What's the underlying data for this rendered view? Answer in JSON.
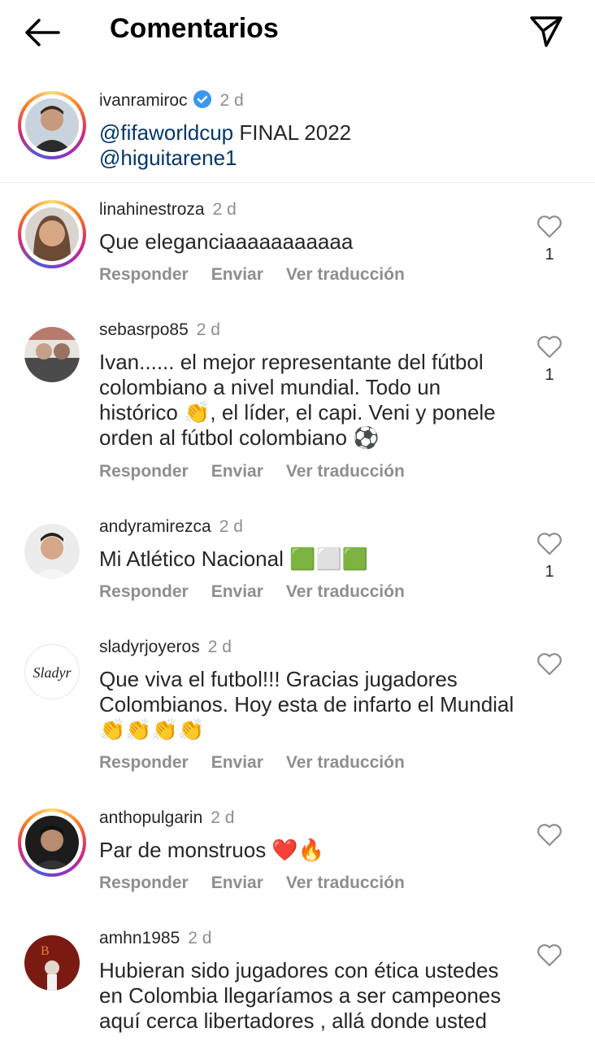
{
  "header": {
    "title": "Comentarios"
  },
  "caption": {
    "username": "ivanramiroc",
    "time": "2 d",
    "mention1": "@fifaworldcup",
    "text1": " FINAL 2022",
    "mention2": "@higuitarene1"
  },
  "actions": {
    "reply": "Responder",
    "send": "Enviar",
    "translate": "Ver traducción"
  },
  "comments": [
    {
      "username": "linahinestroza",
      "time": "2 d",
      "text": "Que eleganciaaaaaaaaaaa",
      "likes": "1"
    },
    {
      "username": "sebasrpo85",
      "time": "2 d",
      "text": "Ivan...... el mejor representante del fútbol colombiano a nivel mundial. Todo un histórico 👏, el líder, el capi. Veni y ponele orden al fútbol colombiano ⚽",
      "likes": "1"
    },
    {
      "username": "andyramirezca",
      "time": "2 d",
      "text": "Mi Atlético Nacional 🟩⬜🟩",
      "likes": "1"
    },
    {
      "username": "sladyrjoyeros",
      "time": "2 d",
      "text": "Que viva el futbol!!! Gracias jugadores Colombianos.  Hoy esta de infarto el Mundial 👏👏👏👏",
      "likes": ""
    },
    {
      "username": "anthopulgarin",
      "time": "2 d",
      "text": "Par de monstruos ❤️🔥",
      "likes": ""
    },
    {
      "username": "amhn1985",
      "time": "2 d",
      "text": "Hubieran sido jugadores con ética ustedes en Colombia llegaríamos a ser campeones aquí cerca libertadores , allá donde usted",
      "likes": ""
    }
  ],
  "sladyr_logo": "Sladyr"
}
